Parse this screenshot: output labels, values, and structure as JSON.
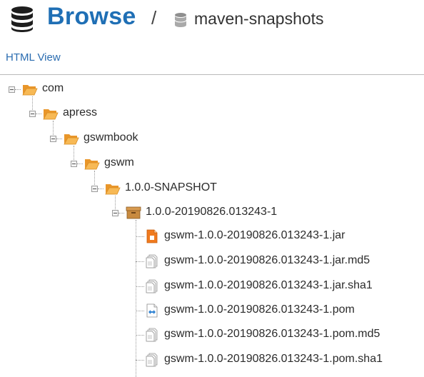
{
  "header": {
    "title": "Browse",
    "separator": "/",
    "repository": "maven-snapshots",
    "icon": "database-icon",
    "repository_icon": "repository-icon"
  },
  "toolbar": {
    "html_view_label": "HTML View"
  },
  "colors": {
    "accent": "#1f6fb5",
    "link": "#2a6cb0",
    "folder": "#f2a43a",
    "jar": "#f07a1e"
  },
  "tree": {
    "nodes": [
      {
        "label": "com",
        "icon": "folder-open-icon"
      },
      {
        "label": "apress",
        "icon": "folder-open-icon"
      },
      {
        "label": "gswmbook",
        "icon": "folder-open-icon"
      },
      {
        "label": "gswm",
        "icon": "folder-open-icon"
      },
      {
        "label": "1.0.0-SNAPSHOT",
        "icon": "folder-open-icon"
      },
      {
        "label": "1.0.0-20190826.013243-1",
        "icon": "package-icon"
      },
      {
        "label": "gswm-1.0.0-20190826.013243-1.jar",
        "icon": "jar-file-icon"
      },
      {
        "label": "gswm-1.0.0-20190826.013243-1.jar.md5",
        "icon": "file-icon"
      },
      {
        "label": "gswm-1.0.0-20190826.013243-1.jar.sha1",
        "icon": "file-icon"
      },
      {
        "label": "gswm-1.0.0-20190826.013243-1.pom",
        "icon": "pom-file-icon"
      },
      {
        "label": "gswm-1.0.0-20190826.013243-1.pom.md5",
        "icon": "file-icon"
      },
      {
        "label": "gswm-1.0.0-20190826.013243-1.pom.sha1",
        "icon": "file-icon"
      }
    ]
  }
}
